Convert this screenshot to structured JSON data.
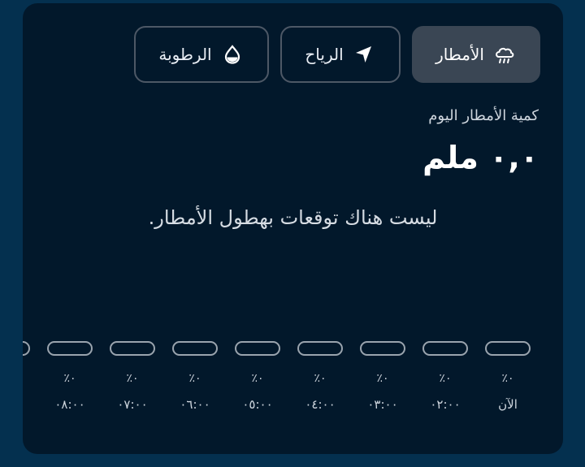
{
  "tabs": [
    {
      "label": "الأمطار",
      "icon": "rain-cloud-icon",
      "active": true
    },
    {
      "label": "الرياح",
      "icon": "navigation-arrow-icon",
      "active": false
    },
    {
      "label": "الرطوبة",
      "icon": "water-drop-icon",
      "active": false
    }
  ],
  "summary": {
    "subtitle": "كمية الأمطار اليوم",
    "amount": "٠,٠ ملم",
    "message": "ليست هناك توقعات بهطول الأمطار."
  },
  "hourly": [
    {
      "time": "الآن",
      "percent": "٪٠"
    },
    {
      "time": "٠٢:٠٠",
      "percent": "٪٠"
    },
    {
      "time": "٠٣:٠٠",
      "percent": "٪٠"
    },
    {
      "time": "٠٤:٠٠",
      "percent": "٪٠"
    },
    {
      "time": "٠٥:٠٠",
      "percent": "٪٠"
    },
    {
      "time": "٠٦:٠٠",
      "percent": "٪٠"
    },
    {
      "time": "٠٧:٠٠",
      "percent": "٪٠"
    },
    {
      "time": "٠٨:٠٠",
      "percent": "٪٠"
    }
  ],
  "colors": {
    "background": "#04304f",
    "card": "#02182b",
    "active_chip": "#3a4654",
    "bar_outline": "#9aa4ae"
  }
}
